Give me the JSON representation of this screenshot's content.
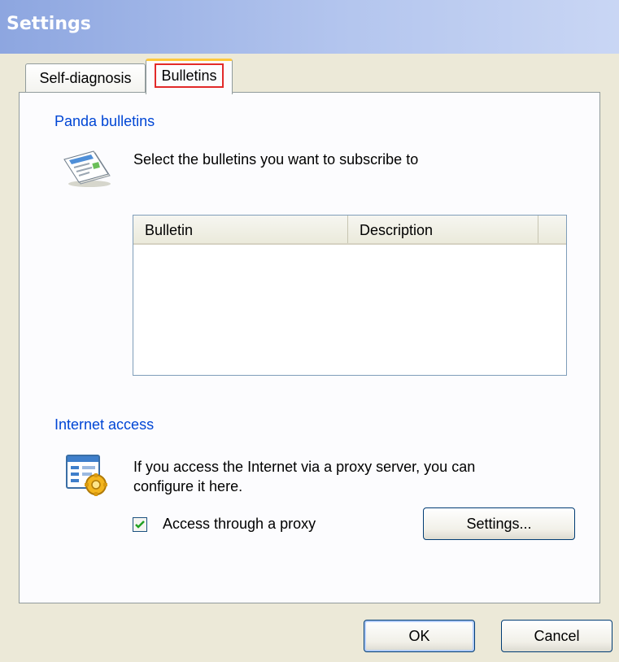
{
  "window": {
    "title": "Settings"
  },
  "tabs": [
    {
      "label": "Self-diagnosis",
      "selected": false
    },
    {
      "label": "Bulletins",
      "selected": true
    }
  ],
  "bulletins_group": {
    "legend": "Panda bulletins",
    "instruction": "Select the bulletins you want to subscribe to",
    "icon": "newsletter-icon",
    "list": {
      "columns": [
        "Bulletin",
        "Description"
      ],
      "rows": []
    }
  },
  "internet_group": {
    "legend": "Internet access",
    "icon": "proxy-settings-icon",
    "description_line1": "If you access the Internet via a proxy server, you can",
    "description_line2": "configure it here.",
    "proxy_checkbox": {
      "label": "Access through a proxy",
      "checked": true
    },
    "settings_button": "Settings..."
  },
  "dialog_buttons": {
    "ok": "OK",
    "cancel": "Cancel"
  },
  "colors": {
    "title_gradient_start": "#8DA6E0",
    "dialog_background": "#ECE9D8",
    "group_legend": "#0046D5",
    "tab_highlight": "#E22A2A"
  }
}
